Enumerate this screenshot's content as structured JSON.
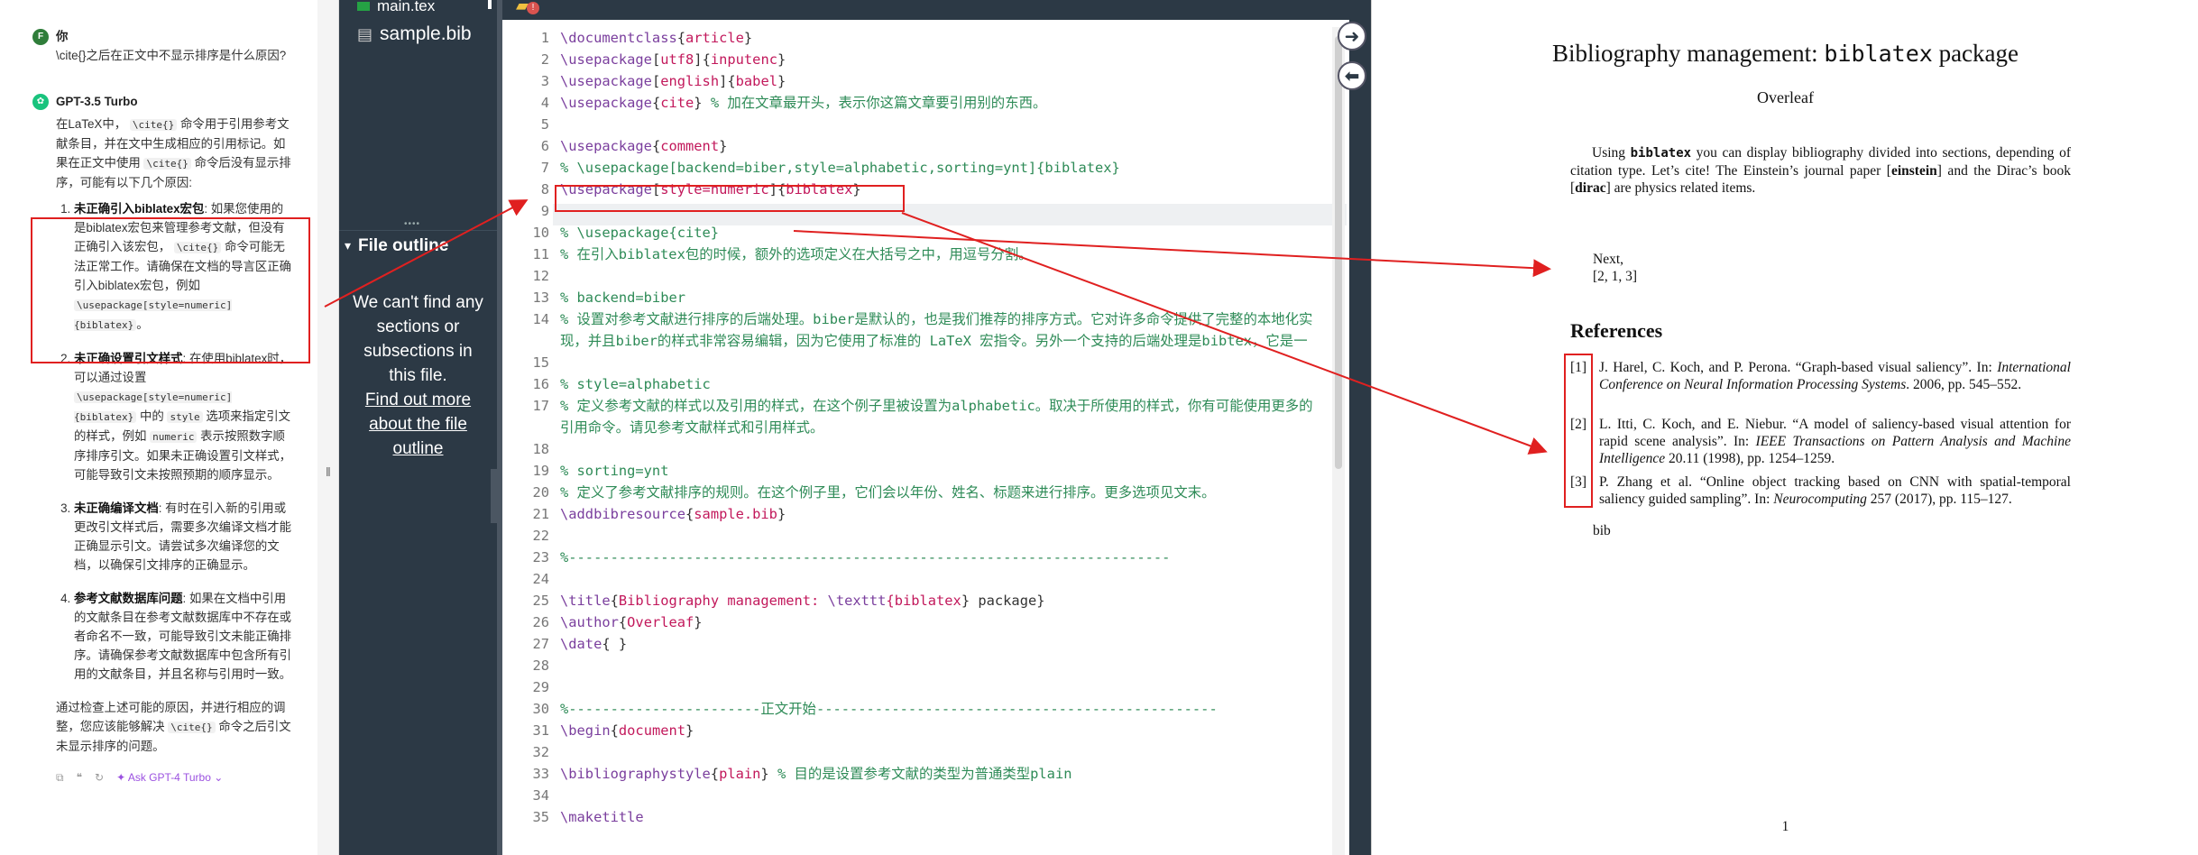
{
  "chat": {
    "user_avatar": "F",
    "user_name": "你",
    "user_question": "\\cite{}之后在正文中不显示排序是什么原因?",
    "gpt_name": "GPT-3.5 Turbo",
    "intro_a": "在LaTeX中，",
    "intro_code": "\\cite{}",
    "intro_b": "命令用于引用参考文献条目，并在文中生成相应的引用标记。如果在正文中使用",
    "intro_code2": "\\cite{}",
    "intro_c": "命令后没有显示排序，可能有以下几个原因:",
    "items": [
      {
        "title": "未正确引入biblatex宏包",
        "text_a": ": 如果您使用的是biblatex宏包来管理参考文献，但没有正确引入该宏包，",
        "code": "\\cite{}",
        "text_b": "命令可能无法正常工作。请确保在文档的导言区正确引入biblatex宏包，例如",
        "code2": "\\usepackage[style=numeric]{biblatex}",
        "text_c": "。"
      },
      {
        "title": "未正确设置引文样式",
        "text_a": ": 在使用biblatex时，可以通过设置",
        "code": "\\usepackage[style=numeric]{biblatex}",
        "text_b": "中的",
        "code2": "style",
        "text_c": "选项来指定引文的样式，例如",
        "code3": "numeric",
        "text_d": "表示按照数字顺序排序引文。如果未正确设置引文样式，可能导致引文未按照预期的顺序显示。"
      },
      {
        "title": "未正确编译文档",
        "text_a": ": 有时在引入新的引用或更改引文样式后，需要多次编译文档才能正确显示引文。请尝试多次编译您的文档，以确保引文排序的正确显示。"
      },
      {
        "title": "参考文献数据库问题",
        "text_a": ": 如果在文档中引用的文献条目在参考文献数据库中不存在或者命名不一致，可能导致引文未能正确排序。请确保参考文献数据库中包含所有引用的文献条目，并且名称与引用时一致。"
      }
    ],
    "outro_a": "通过检查上述可能的原因，并进行相应的调整，您应该能够解决",
    "outro_code": "\\cite{}",
    "outro_b": "命令之后引文未显示排序的问题。",
    "ask_label": "Ask GPT-4 Turbo"
  },
  "sidebar": {
    "file_main": "main.tex",
    "file_bib": "sample.bib",
    "outline_title": "File outline",
    "outline_empty_1": "We can't find any sections or subsections in this file.",
    "outline_link": "Find out more about the file outline"
  },
  "editor": {
    "line_numbers": [
      "1",
      "2",
      "3",
      "4",
      "5",
      "6",
      "7",
      "8",
      "9",
      "10",
      "11",
      "12",
      "13",
      "14",
      "15",
      "16",
      "17",
      "18",
      "19",
      "20",
      "21",
      "22",
      "23",
      "24",
      "25",
      "26",
      "27",
      "28",
      "29",
      "30",
      "31",
      "32",
      "33",
      "34",
      "35"
    ],
    "lines": [
      "\\documentclass{article}",
      "\\usepackage[utf8]{inputenc}",
      "\\usepackage[english]{babel}",
      "\\usepackage{cite} % 加在文章最开头，表示你这篇文章要引用别的东西。",
      "",
      "\\usepackage{comment}",
      "% \\usepackage[backend=biber,style=alphabetic,sorting=ynt]{biblatex}",
      "\\usepackage[style=numeric]{biblatex}",
      "",
      "% \\usepackage{cite}",
      "% 在引入biblatex包的时候，额外的选项定义在大括号之中，用逗号分割。",
      "",
      "% backend=biber",
      "% 设置对参考文献进行排序的后端处理。biber是默认的，也是我们推荐的排序方式。它对许多命令提供了完整的本地化实现，并且biber的样式非常容易编辑，因为它使用了标准的 LaTeX 宏指令。另外一个支持的后端处理是bibtex，它是一个比较传统的程序，它只被用来对参考文献进行排序，不可以用来设置bibtex的样式。",
      "",
      "% style=alphabetic",
      "% 定义参考文献的样式以及引用的样式，在这个例子里被设置为alphabetic。取决于所使用的样式，你有可能使用更多的引用命令。请见参考文献样式和引用样式。",
      "",
      "% sorting=ynt",
      "% 定义了参考文献排序的规则。在这个例子里，它们会以年份、姓名、标题来进行排序。更多选项见文末。",
      "\\addbibresource{sample.bib}",
      "",
      "%------------------------------------------------------------------------",
      "",
      "\\title{Bibliography management: \\texttt{biblatex} package}",
      "\\author{Overleaf}",
      "\\date{ }",
      "",
      "",
      "%-----------------------正文开始------------------------------------------------",
      "\\begin{document}",
      "",
      "\\bibliographystyle{plain}     % 目的是设置参考文献的类型为普通类型plain",
      "",
      "\\maketitle"
    ]
  },
  "pdf": {
    "title_a": "Bibliography management: ",
    "title_code": "biblatex",
    "title_b": " package",
    "author": "Overleaf",
    "para_a": "Using ",
    "para_code": "biblatex",
    "para_b": " you can display bibliography divided into sections, depending of citation type. Let’s cite! The Einstein’s journal paper [",
    "para_cite1": "einstein",
    "para_c": "] and the Dirac’s book [",
    "para_cite2": "dirac",
    "para_d": "] are physics related items.",
    "next_1": "Next,",
    "next_2": "[2, 1, 3]",
    "references_title": "References",
    "refs": [
      {
        "num": "[1]",
        "text_a": "J. Harel, C. Koch, and P. Perona. “Graph-based visual saliency”. In: ",
        "ital": "International Conference on Neural Information Processing Systems",
        "text_b": ". 2006, pp. 545–552."
      },
      {
        "num": "[2]",
        "text_a": "L. Itti, C. Koch, and E. Niebur. “A model of saliency-based visual attention for rapid scene analysis”. In: ",
        "ital": "IEEE Transactions on Pattern Analysis and Machine Intelligence",
        "text_b": " 20.11 (1998), pp. 1254–1259."
      },
      {
        "num": "[3]",
        "text_a": "P. Zhang et al. “Online object tracking based on CNN with spatial-temporal saliency guided sampling”. In: ",
        "ital": "Neurocomputing",
        "text_b": " 257 (2017), pp. 115–127."
      }
    ],
    "bib_text": "bib",
    "page_number": "1"
  },
  "colors": {
    "annotation": "#e02020",
    "sidebar": "#2c3945",
    "gpt": "#19c37d",
    "ask": "#9b51e0"
  }
}
